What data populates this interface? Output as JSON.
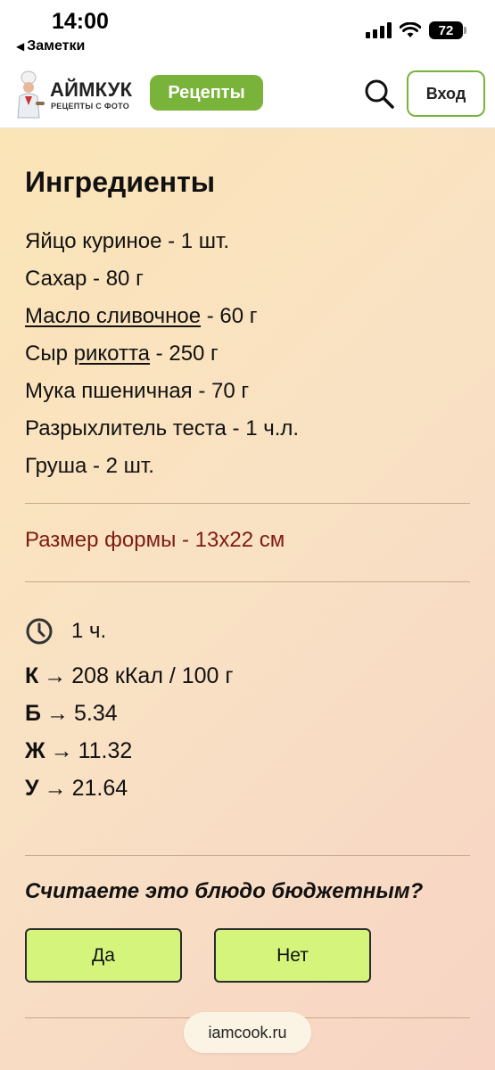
{
  "status_bar": {
    "time": "14:00",
    "back_app": "Заметки",
    "battery": "72"
  },
  "header": {
    "logo_title": "АЙМКУК",
    "logo_subtitle": "РЕЦЕПТЫ С ФОТО",
    "recipes_label": "Рецепты",
    "login_label": "Вход",
    "accent_color": "#7ab33a"
  },
  "ingredients": {
    "heading": "Ингредиенты",
    "items": [
      {
        "name": "Яйцо куриное",
        "amount": " - 1 шт."
      },
      {
        "name": "Сахар",
        "amount": " - 80 г"
      },
      {
        "name": "Масло сливочное",
        "amount": " - 60 г"
      },
      {
        "prefix": "Сыр ",
        "name": "рикотта",
        "amount": " - 250 г"
      },
      {
        "name": "Мука пшеничная",
        "amount": " - 70 г"
      },
      {
        "name": "Разрыхлитель теста",
        "amount": " - 1 ч.л."
      },
      {
        "name": "Груша",
        "amount": " - 2 шт."
      }
    ]
  },
  "form_size": "Размер формы - 13x22 см",
  "cook_time": "1 ч.",
  "nutrition": [
    {
      "key": "К",
      "value": "208 кКал / 100 г"
    },
    {
      "key": "Б",
      "value": "5.34"
    },
    {
      "key": "Ж",
      "value": "11.32"
    },
    {
      "key": "У",
      "value": "21.64"
    }
  ],
  "budget_poll": {
    "question": "Считаете это блюдо бюджетным?",
    "yes_label": "Да",
    "no_label": "Нет"
  },
  "url": "iamcook.ru"
}
